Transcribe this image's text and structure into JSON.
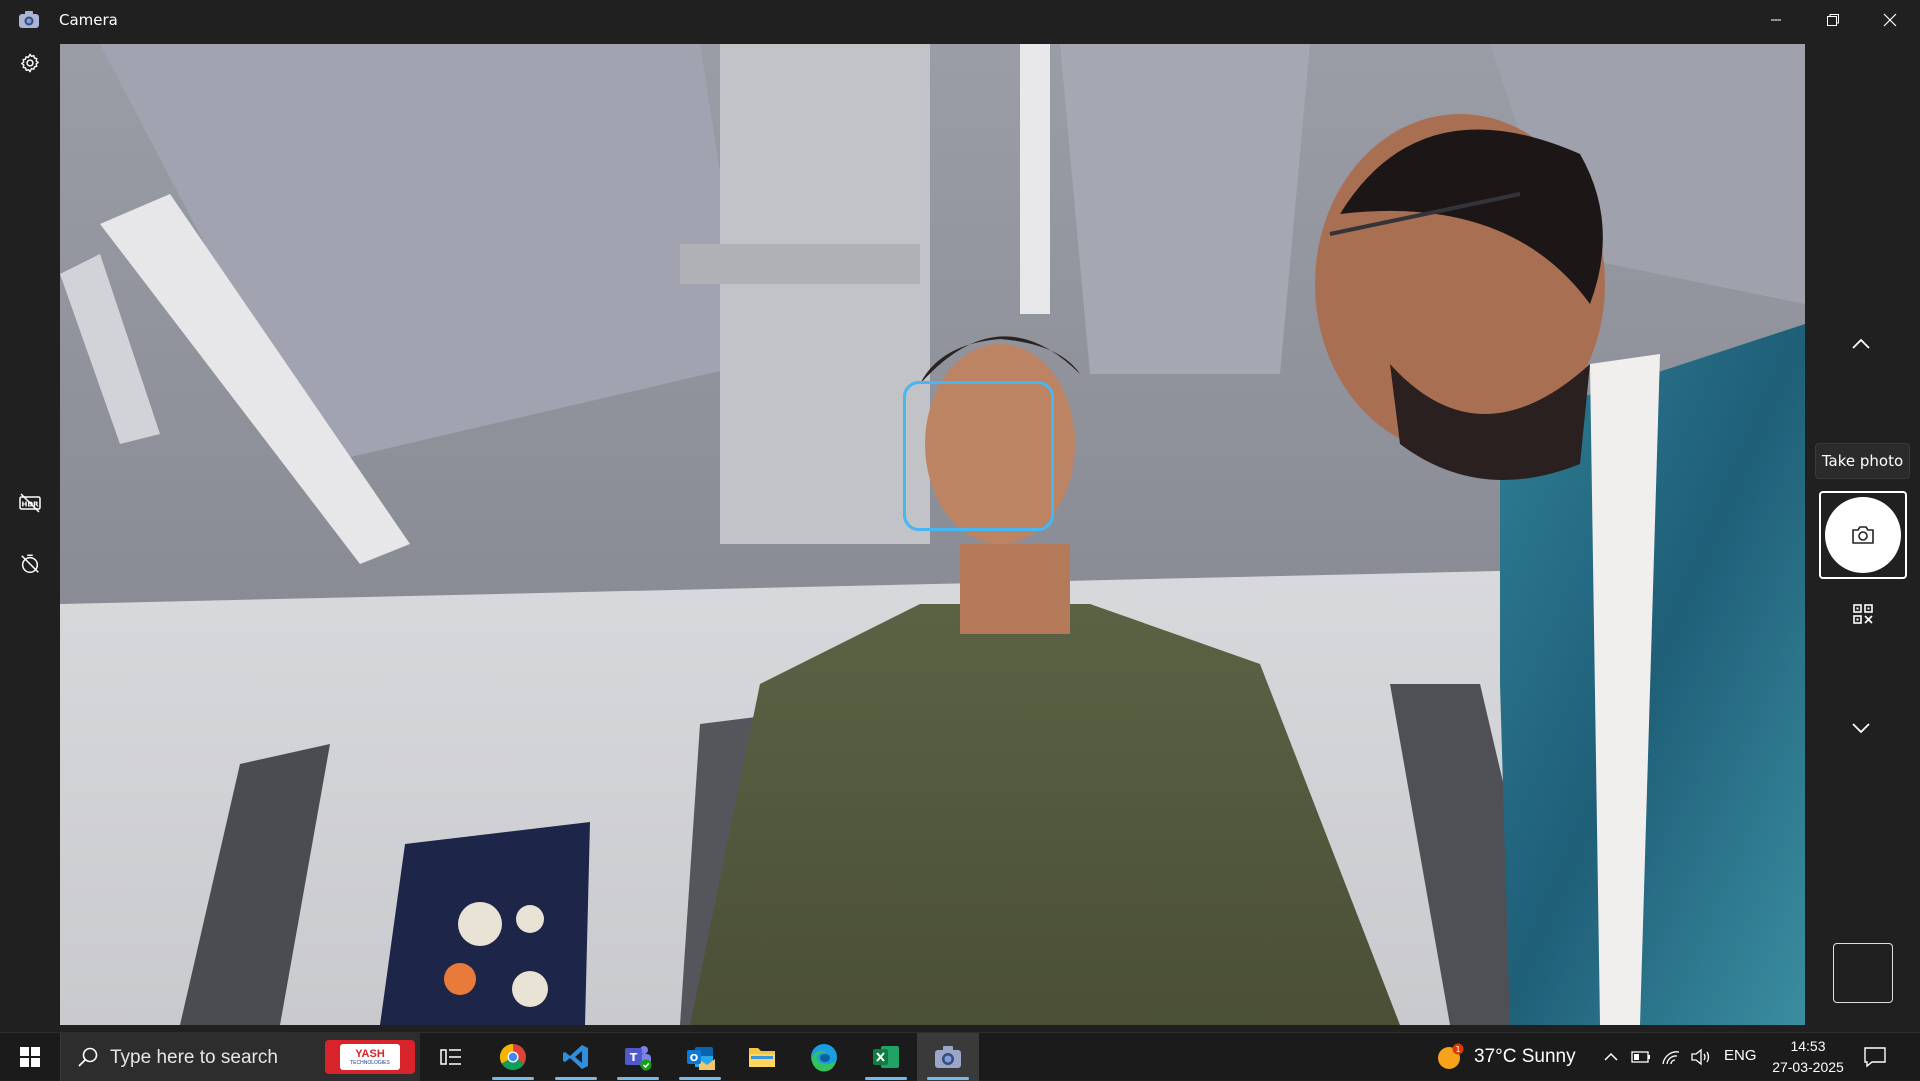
{
  "window": {
    "title": "Camera",
    "controls": [
      "minimize",
      "restore",
      "close"
    ]
  },
  "left_rail": {
    "items": [
      {
        "name": "settings",
        "icon": "gear-icon"
      },
      {
        "name": "hdr-off",
        "icon": "hdr-off-icon"
      },
      {
        "name": "timer-off",
        "icon": "timer-off-icon"
      }
    ]
  },
  "viewfinder": {
    "face_detection": true,
    "face_box_color": "#48b6f0"
  },
  "right_rail": {
    "tooltip": "Take photo",
    "mode_up_icon": "chevron-up-icon",
    "shutter_icon": "camera-icon",
    "qr_icon": "qr-code-icon",
    "mode_down_icon": "chevron-down-icon"
  },
  "taskbar": {
    "search_placeholder": "Type here to search",
    "search_banner": {
      "title": "YASH",
      "subtitle": "TECHNOLOGIES"
    },
    "pinned_apps": [
      {
        "name": "task-view",
        "icon": "task-view-icon",
        "active": false
      },
      {
        "name": "chrome",
        "icon": "chrome-icon",
        "active": false
      },
      {
        "name": "vscode",
        "icon": "vscode-icon",
        "active": false
      },
      {
        "name": "teams",
        "icon": "teams-icon",
        "active": false
      },
      {
        "name": "outlook",
        "icon": "outlook-icon",
        "active": false
      },
      {
        "name": "file-explorer",
        "icon": "folder-icon",
        "active": false
      },
      {
        "name": "edge",
        "icon": "edge-icon",
        "active": false
      },
      {
        "name": "excel",
        "icon": "excel-icon",
        "active": false
      },
      {
        "name": "camera",
        "icon": "camera-icon",
        "active": true
      }
    ],
    "weather": {
      "text": "37°C  Sunny",
      "badge": "1"
    },
    "language": "ENG",
    "time": "14:53",
    "date": "27-03-2025"
  }
}
